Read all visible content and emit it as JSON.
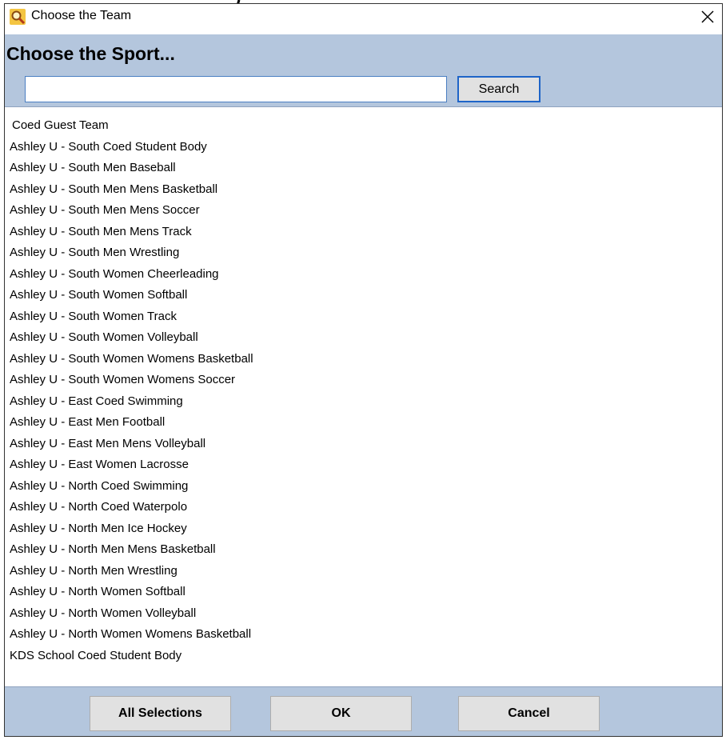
{
  "window": {
    "title": "Choose the Team",
    "close_glyph": "✕",
    "app_icon": "magnifier-icon"
  },
  "header": {
    "title": "Choose the Sport...",
    "background_color": "#b4c6dd"
  },
  "search": {
    "value": "",
    "placeholder": "",
    "button_label": "Search"
  },
  "teams": [
    "Coed Guest Team",
    "Ashley U  - South Coed Student Body",
    "Ashley U  - South Men Baseball",
    "Ashley U  - South Men Mens Basketball",
    "Ashley U  - South Men Mens Soccer",
    "Ashley U  - South Men Mens Track",
    "Ashley U  - South Men Wrestling",
    "Ashley U  - South Women Cheerleading",
    "Ashley U  - South Women Softball",
    "Ashley U  - South Women Track",
    "Ashley U  - South Women Volleyball",
    "Ashley U  - South Women Womens Basketball",
    "Ashley U  - South Women Womens Soccer",
    "Ashley U -  East Coed Swimming",
    "Ashley U -  East Men Football",
    "Ashley U -  East Men Mens Volleyball",
    "Ashley U -  East Women Lacrosse",
    "Ashley U -  North Coed Swimming",
    "Ashley U -  North Coed Waterpolo",
    "Ashley U -  North Men Ice Hockey",
    "Ashley U -  North Men Mens Basketball",
    "Ashley U -  North Men Wrestling",
    "Ashley U -  North Women Softball",
    "Ashley U -  North Women Volleyball",
    "Ashley U -  North Women Womens Basketball",
    "KDS School Coed Student Body"
  ],
  "footer": {
    "all_selections_label": "All Selections",
    "ok_label": "OK",
    "cancel_label": "Cancel"
  }
}
